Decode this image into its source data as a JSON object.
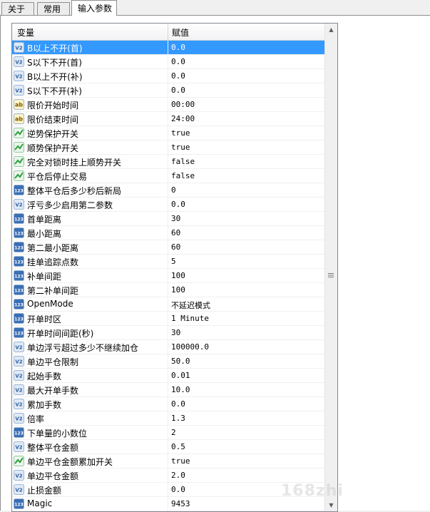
{
  "tabs": [
    {
      "label": "关于"
    },
    {
      "label": "常用"
    },
    {
      "label": "输入参数"
    }
  ],
  "grid": {
    "col_variable": "变量",
    "col_value": "赋值"
  },
  "rows": [
    {
      "icon": "double",
      "name": "B以上不开(首)",
      "value": "0.0",
      "selected": true
    },
    {
      "icon": "double",
      "name": "S以下不开(首)",
      "value": "0.0"
    },
    {
      "icon": "double",
      "name": "B以上不开(补)",
      "value": "0.0"
    },
    {
      "icon": "double",
      "name": "S以下不开(补)",
      "value": "0.0"
    },
    {
      "icon": "string",
      "name": "限价开始时间",
      "value": "00:00"
    },
    {
      "icon": "string",
      "name": "限价结束时间",
      "value": "24:00"
    },
    {
      "icon": "bool",
      "name": "逆势保护开关",
      "value": "true"
    },
    {
      "icon": "bool",
      "name": "顺势保护开关",
      "value": "true"
    },
    {
      "icon": "bool",
      "name": "完全对锁时挂上顺势开关",
      "value": "false"
    },
    {
      "icon": "bool",
      "name": "平仓后停止交易",
      "value": "false"
    },
    {
      "icon": "int",
      "name": "整体平仓后多少秒后新局",
      "value": "0"
    },
    {
      "icon": "double",
      "name": "浮亏多少启用第二参数",
      "value": "0.0"
    },
    {
      "icon": "int",
      "name": "首单距离",
      "value": "30"
    },
    {
      "icon": "int",
      "name": "最小距离",
      "value": "60"
    },
    {
      "icon": "int",
      "name": "第二最小距离",
      "value": "60"
    },
    {
      "icon": "int",
      "name": "挂单追踪点数",
      "value": "5"
    },
    {
      "icon": "int",
      "name": "补单间距",
      "value": "100"
    },
    {
      "icon": "int",
      "name": "第二补单间距",
      "value": "100"
    },
    {
      "icon": "int",
      "name": "OpenMode",
      "value": "不延迟模式"
    },
    {
      "icon": "int",
      "name": "开单时区",
      "value": "1 Minute"
    },
    {
      "icon": "int",
      "name": "开单时间间距(秒)",
      "value": "30"
    },
    {
      "icon": "double",
      "name": "单边浮亏超过多少不继续加仓",
      "value": "100000.0"
    },
    {
      "icon": "double",
      "name": "单边平仓限制",
      "value": "50.0"
    },
    {
      "icon": "double",
      "name": "起始手数",
      "value": "0.01"
    },
    {
      "icon": "double",
      "name": "最大开单手数",
      "value": "10.0"
    },
    {
      "icon": "double",
      "name": "累加手数",
      "value": "0.0"
    },
    {
      "icon": "double",
      "name": "倍率",
      "value": "1.3"
    },
    {
      "icon": "int",
      "name": "下单量的小数位",
      "value": "2"
    },
    {
      "icon": "double",
      "name": "整体平仓金额",
      "value": "0.5"
    },
    {
      "icon": "bool",
      "name": "单边平仓金额累加开关",
      "value": "true"
    },
    {
      "icon": "double",
      "name": "单边平仓金额",
      "value": "2.0"
    },
    {
      "icon": "double",
      "name": "止损金额",
      "value": "0.0"
    },
    {
      "icon": "int",
      "name": "Magic",
      "value": "9453"
    }
  ],
  "icon_labels": {
    "double": "V2",
    "string": "ab",
    "int": "123"
  },
  "colors": {
    "selection": "#3399ff",
    "double_icon": "#5b9bd5",
    "string_icon": "#e8a317",
    "bool_icon": "#2e9e3e",
    "int_icon": "#3a6fb5"
  },
  "watermark": "168zhi"
}
